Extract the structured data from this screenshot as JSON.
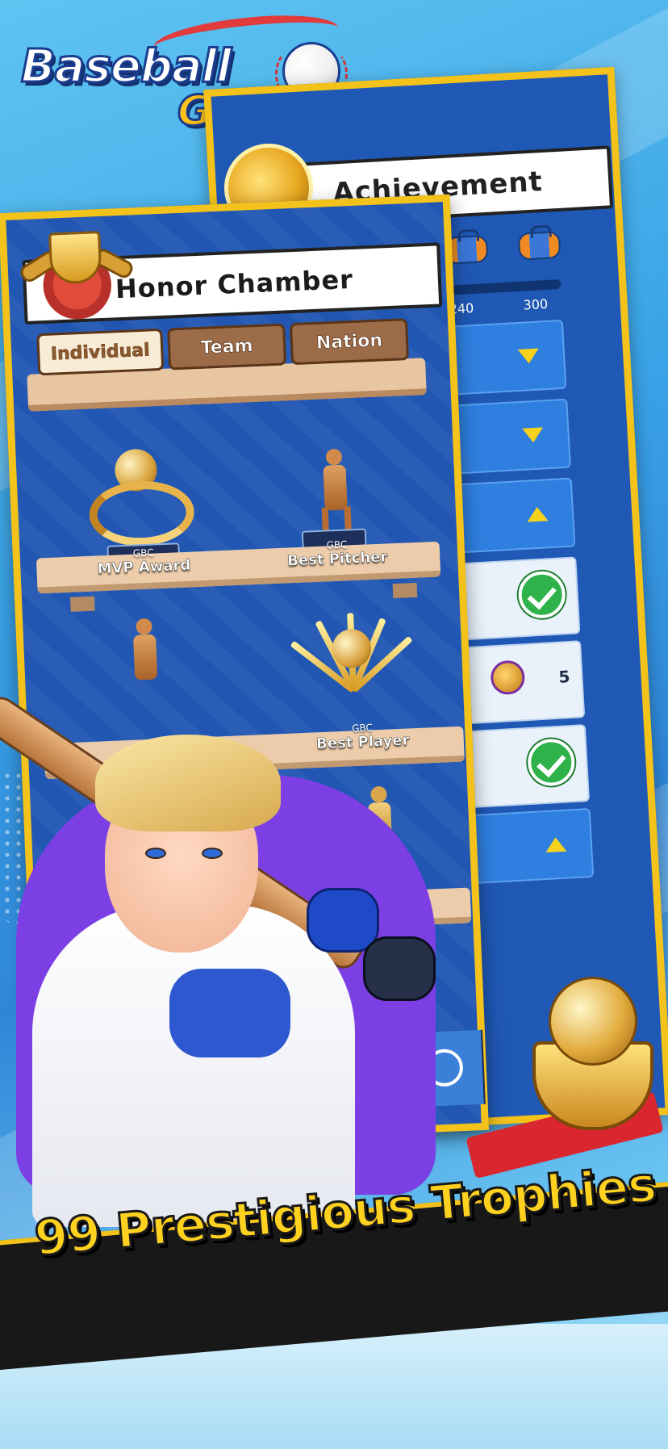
{
  "logo": {
    "title": "Baseball",
    "subtitle": "GOAT"
  },
  "achievement_panel": {
    "title": "Achievement",
    "progress_labels": [
      "240",
      "300"
    ],
    "rows": [
      {
        "state": "collapsed-down"
      },
      {
        "state": "collapsed-down"
      },
      {
        "state": "expanded-up"
      },
      {
        "state": "completed"
      },
      {
        "state": "reward",
        "reward_count": "5"
      },
      {
        "state": "completed"
      },
      {
        "state": "expanded-up"
      }
    ]
  },
  "honor_chamber": {
    "title": "Honor Chamber",
    "tabs": [
      {
        "label": "Individual",
        "active": true
      },
      {
        "label": "Team",
        "active": false
      },
      {
        "label": "Nation",
        "active": false
      }
    ],
    "trophies": [
      {
        "org": "GBC",
        "name": "MVP Award"
      },
      {
        "org": "GBC",
        "name": "Best Pitcher"
      },
      {
        "org": "GBC",
        "name": "Best Player"
      }
    ]
  },
  "banner": {
    "text": "99 Prestigious Trophies"
  },
  "colors": {
    "panel_blue": "#2157b3",
    "frame_gold": "#f3c21b",
    "banner_yellow": "#ffd21f",
    "check_green": "#2fb24a"
  }
}
